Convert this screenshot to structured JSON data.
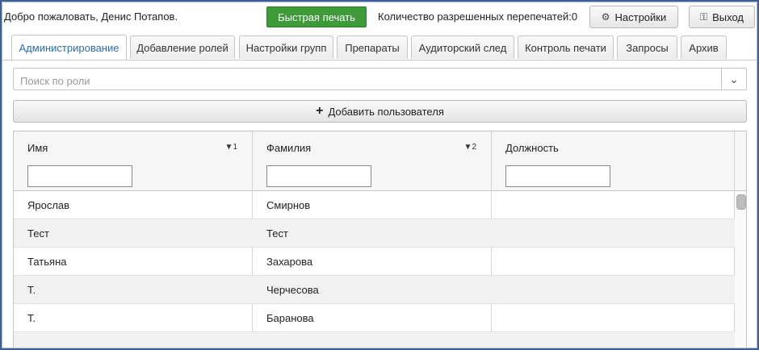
{
  "header": {
    "welcome": "Добро пожаловать, Денис Потапов.",
    "quick_print": "Быстрая печать",
    "reprints": "Количество разрешенных перепечатей:0",
    "settings": "Настройки",
    "exit": "Выход",
    "accent_green": "#3f9b3a"
  },
  "tabs": [
    {
      "label": "Администрирование",
      "active": true
    },
    {
      "label": "Добавление ролей"
    },
    {
      "label": "Настройки групп"
    },
    {
      "label": "Препараты"
    },
    {
      "label": "Аудиторский след"
    },
    {
      "label": "Контроль печати"
    },
    {
      "label": "Запросы"
    },
    {
      "label": "Архив"
    }
  ],
  "search": {
    "placeholder": "Поиск по роли"
  },
  "add_user": "Добавить пользователя",
  "grid": {
    "columns": [
      {
        "label": "Имя",
        "sort": "1"
      },
      {
        "label": "Фамилия",
        "sort": "2"
      },
      {
        "label": "Должность",
        "sort": ""
      }
    ],
    "rows": [
      [
        "Ярослав",
        "Смирнов",
        ""
      ],
      [
        "Тест",
        "Тест",
        ""
      ],
      [
        "Татьяна",
        "Захарова",
        ""
      ],
      [
        "Т.",
        "Черчесова",
        ""
      ],
      [
        "Т.",
        "Баранова",
        ""
      ]
    ]
  },
  "icons": {
    "settings": "gears-icon",
    "exit": "key-icon",
    "add": "plus-icon",
    "dropdown": "chevron-down-icon",
    "sort": "caret-down-icon"
  }
}
